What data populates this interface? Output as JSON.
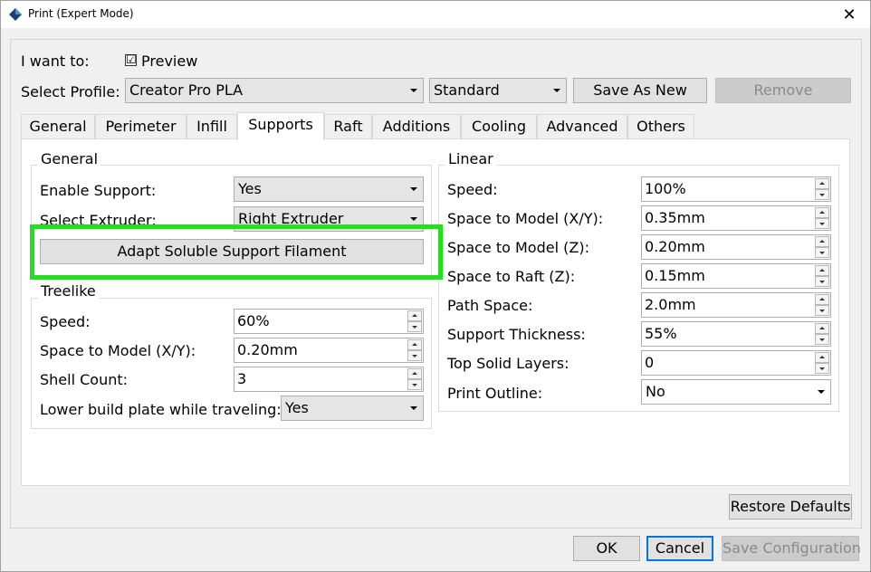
{
  "window": {
    "title": "Print (Expert Mode)",
    "close": "✕"
  },
  "top": {
    "want_label": "I want to:",
    "preview_label": "Preview",
    "preview_checked": "☑",
    "profile_label": "Select Profile:",
    "profile_value": "Creator Pro PLA",
    "quality_value": "Standard",
    "save_as_new": "Save As New",
    "remove": "Remove"
  },
  "tabs": [
    "General",
    "Perimeter",
    "Infill",
    "Supports",
    "Raft",
    "Additions",
    "Cooling",
    "Advanced",
    "Others"
  ],
  "general": {
    "title": "General",
    "enable_label": "Enable Support:",
    "enable_value": "Yes",
    "extruder_label": "Select Extruder:",
    "extruder_value": "Right Extruder",
    "adapt_button": "Adapt Soluble Support Filament"
  },
  "treelike": {
    "title": "Treelike",
    "speed_label": "Speed:",
    "speed_value": "60%",
    "space_xy_label": "Space to Model (X/Y):",
    "space_xy_value": "0.20mm",
    "shell_label": "Shell Count:",
    "shell_value": "3",
    "lower_label": "Lower build plate while traveling:",
    "lower_value": "Yes"
  },
  "linear": {
    "title": "Linear",
    "speed_label": "Speed:",
    "speed_value": "100%",
    "space_xy_label": "Space to Model (X/Y):",
    "space_xy_value": "0.35mm",
    "space_z_label": "Space to Model (Z):",
    "space_z_value": "0.20mm",
    "raft_label": "Space to Raft (Z):",
    "raft_value": "0.15mm",
    "path_label": "Path Space:",
    "path_value": "2.0mm",
    "thickness_label": "Support Thickness:",
    "thickness_value": "55%",
    "top_label": "Top Solid Layers:",
    "top_value": "0",
    "outline_label": "Print Outline:",
    "outline_value": "No"
  },
  "footer": {
    "restore": "Restore Defaults",
    "ok": "OK",
    "cancel": "Cancel",
    "save_config": "Save Configuration"
  }
}
